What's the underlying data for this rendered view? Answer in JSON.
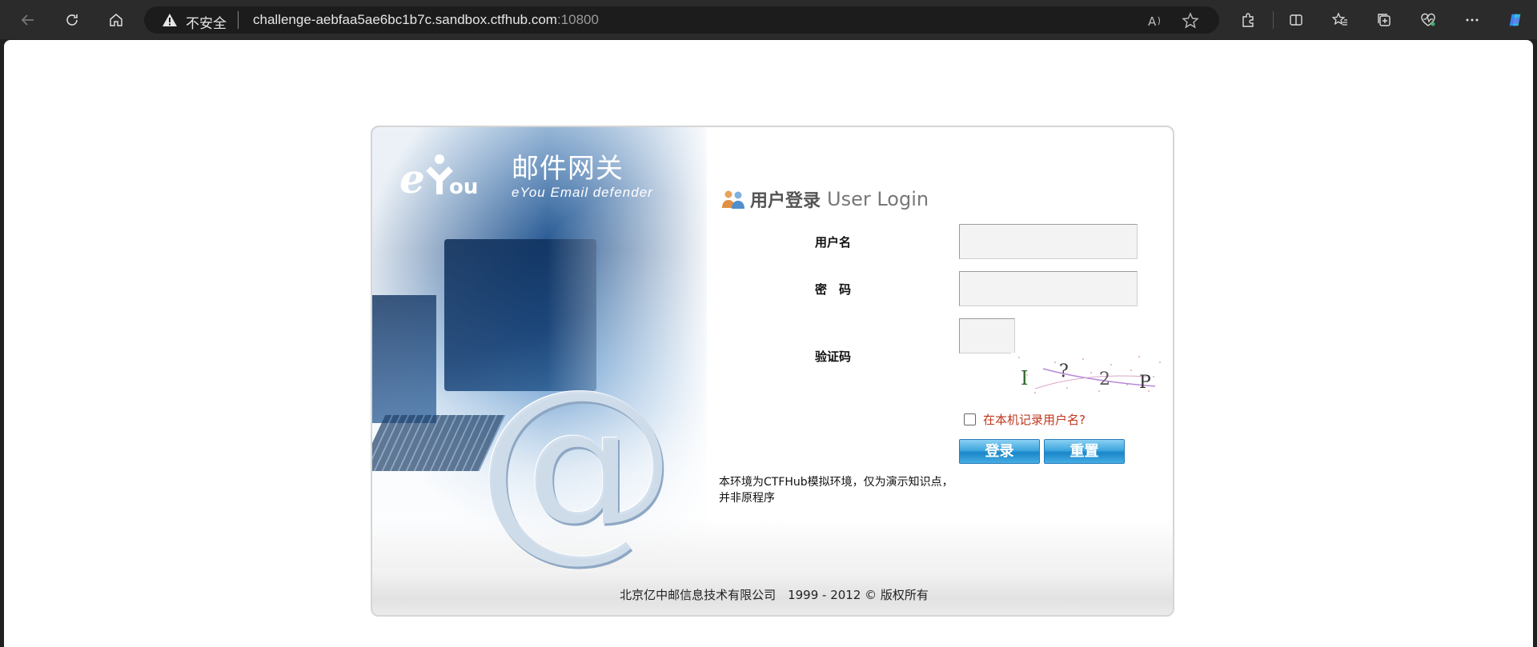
{
  "browser": {
    "security_label": "不安全",
    "url_host": "challenge-aebfaa5ae6bc1b7c.sandbox.ctfhub.com",
    "url_port": ":10800"
  },
  "logo": {
    "name_cn": "邮件网关",
    "name_en": "eYou Email defender"
  },
  "login": {
    "title_cn": "用户登录",
    "title_en": "User Login",
    "username_label": "用户名",
    "password_label": "密　码",
    "captcha_label": "验证码",
    "captcha_text": "I ? 2 P",
    "remember_label": "在本机记录用户名?",
    "login_button": "登录",
    "reset_button": "重置",
    "notice": "本环境为CTFHub模拟环境，仅为演示知识点，并非原程序"
  },
  "footer": {
    "copyright": "北京亿中邮信息技术有限公司　1999 - 2012 © 版权所有"
  },
  "colors": {
    "accent_blue": "#1b86c9",
    "link_red": "#c0361d"
  }
}
